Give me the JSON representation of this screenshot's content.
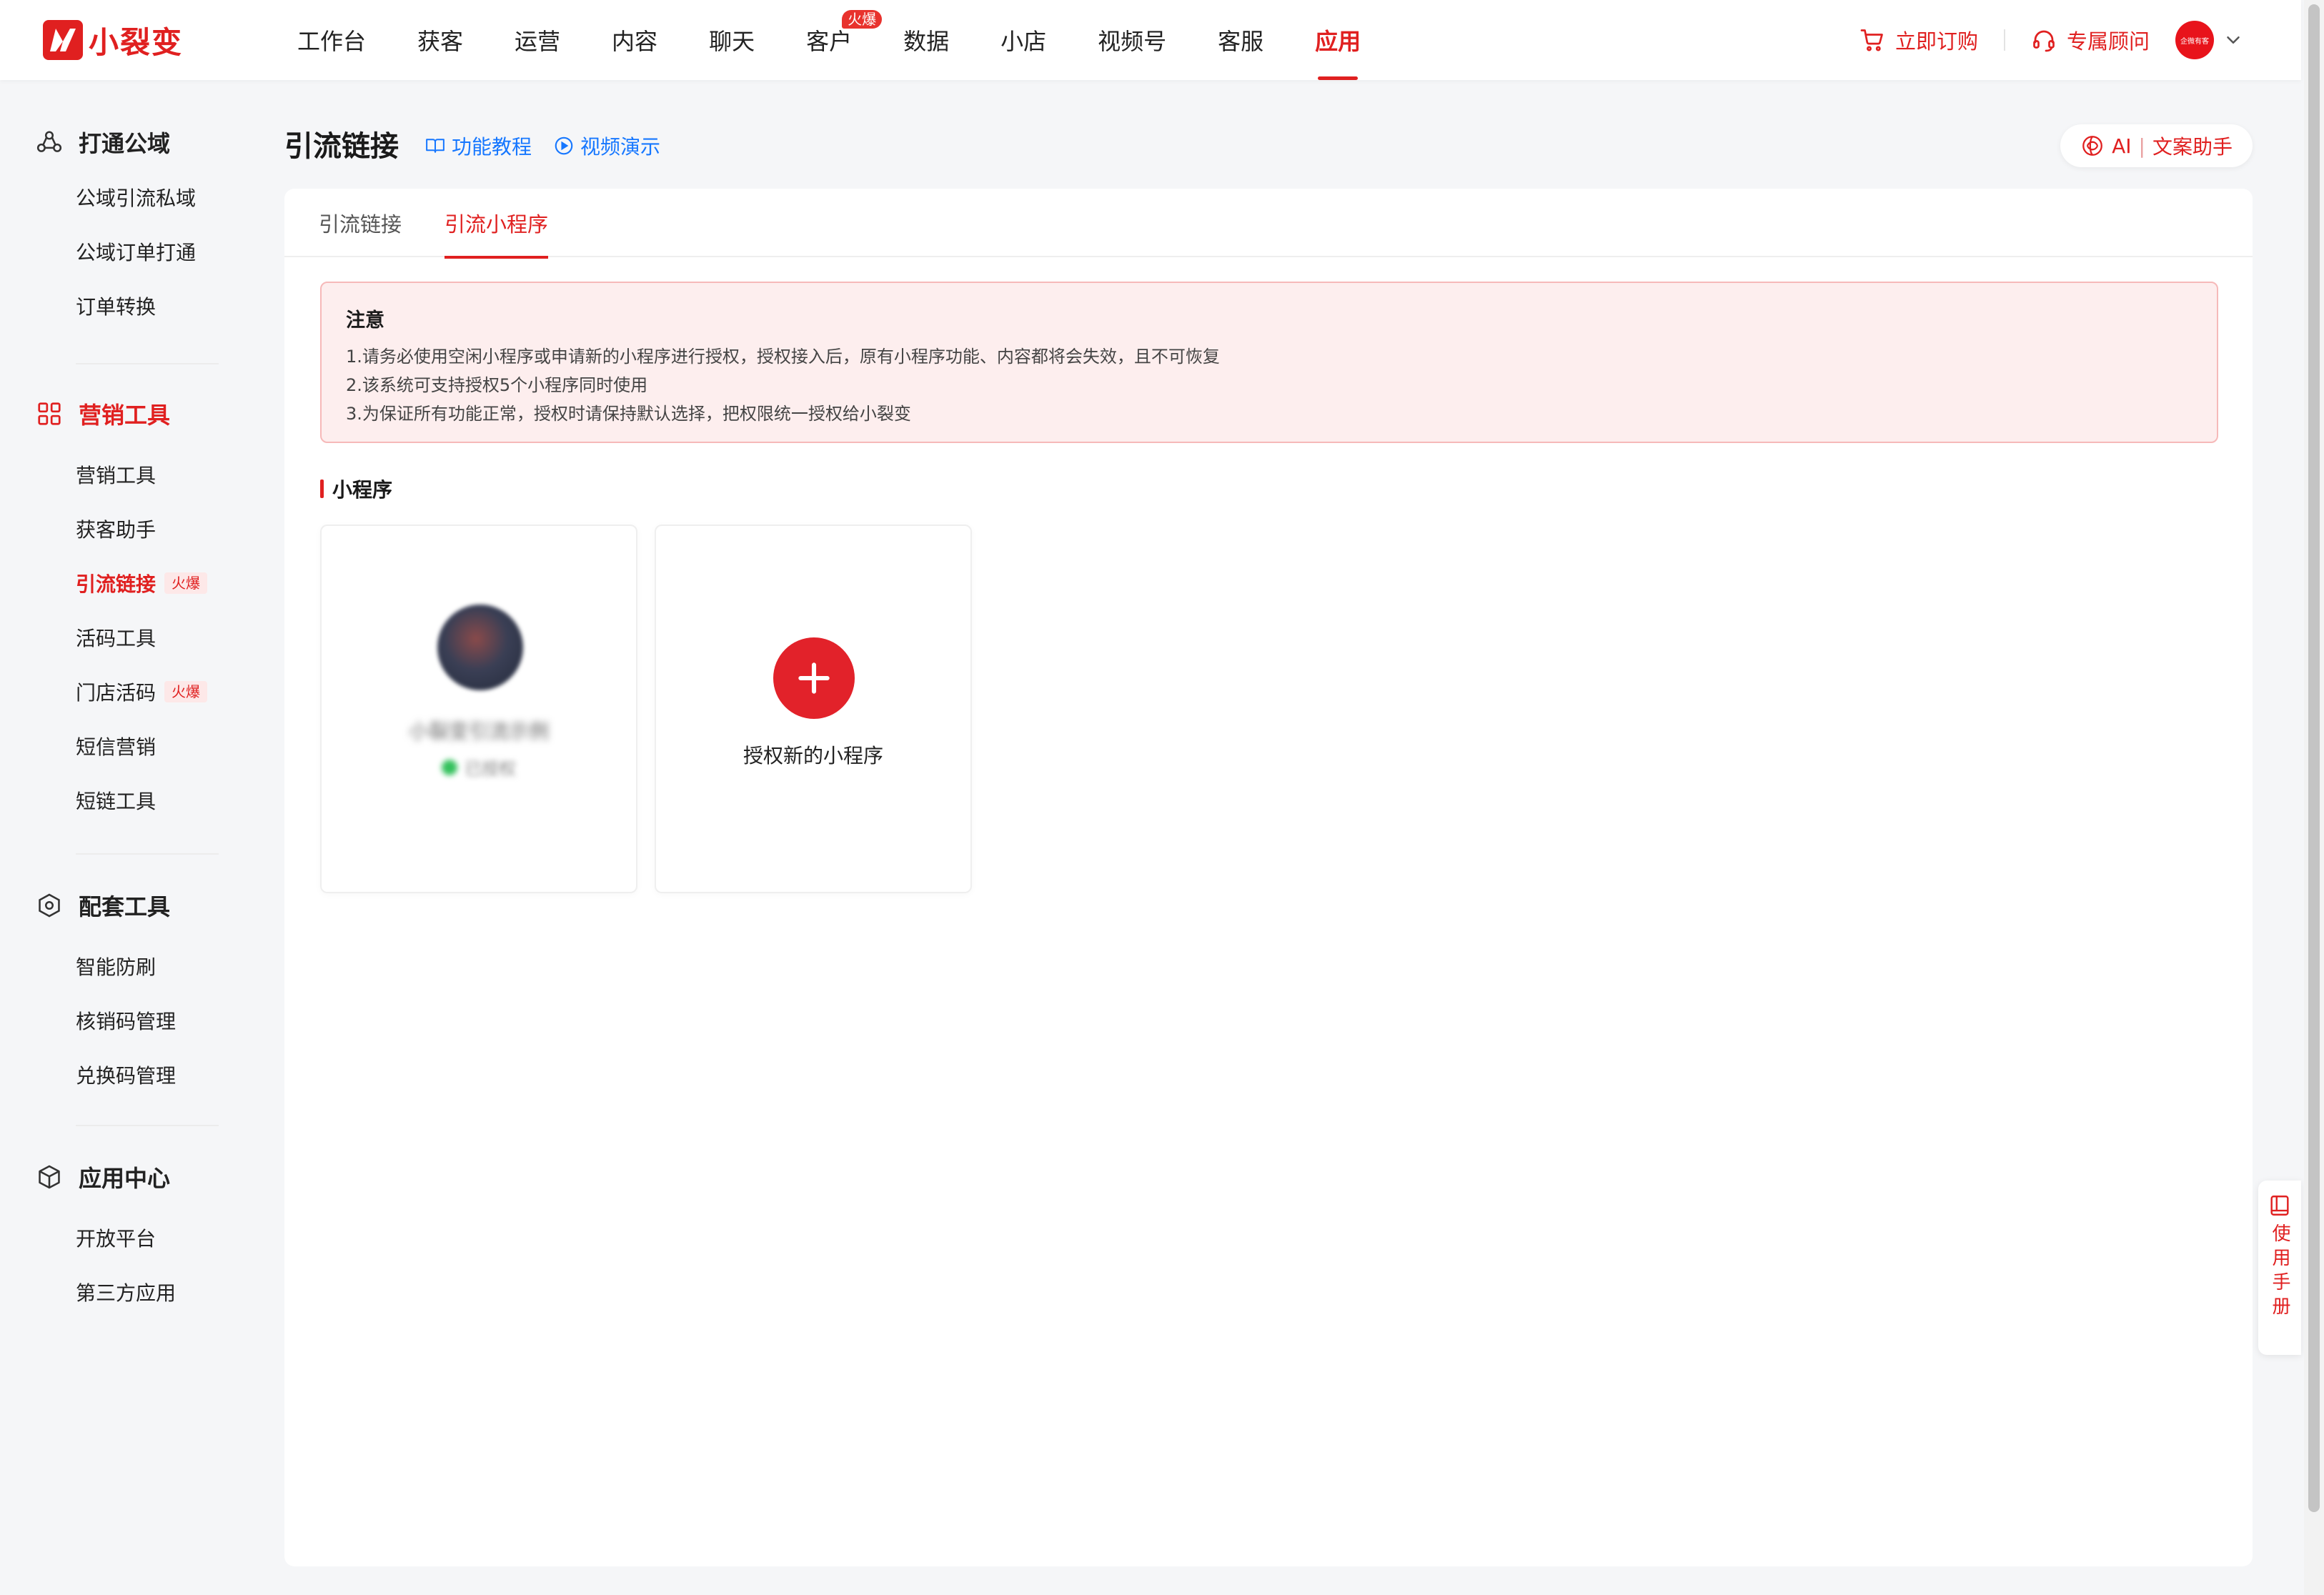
{
  "brand": {
    "name": "小裂变",
    "color": "#e02020"
  },
  "nav": {
    "items": [
      {
        "label": "工作台"
      },
      {
        "label": "获客"
      },
      {
        "label": "运营"
      },
      {
        "label": "内容"
      },
      {
        "label": "聊天"
      },
      {
        "label": "客户",
        "badge": "火爆"
      },
      {
        "label": "数据"
      },
      {
        "label": "小店"
      },
      {
        "label": "视频号"
      },
      {
        "label": "客服"
      },
      {
        "label": "应用",
        "active": true
      }
    ]
  },
  "topright": {
    "order_label": "立即订购",
    "advisor_label": "专属顾问",
    "avatar_text": "企微有客"
  },
  "sidebar": {
    "groups": [
      {
        "title": "打通公域",
        "icon": "globe-share-icon",
        "items": [
          "公域引流私域",
          "公域订单打通",
          "订单转换"
        ]
      },
      {
        "title": "营销工具",
        "icon": "grid-icon",
        "active": true,
        "items": [
          "营销工具",
          "获客助手",
          "引流链接",
          "活码工具",
          "门店活码",
          "短信营销",
          "短链工具"
        ],
        "tags": {
          "引流链接": "火爆",
          "门店活码": "火爆"
        },
        "active_item": "引流链接"
      },
      {
        "title": "配套工具",
        "icon": "hexagon-icon",
        "items": [
          "智能防刷",
          "核销码管理",
          "兑换码管理"
        ]
      },
      {
        "title": "应用中心",
        "icon": "box-icon",
        "items": [
          "开放平台",
          "第三方应用"
        ]
      }
    ]
  },
  "page": {
    "title": "引流链接",
    "tutorial_label": "功能教程",
    "video_label": "视频演示",
    "ai_label_a": "AI",
    "ai_sep": "|",
    "ai_label_b": "文案助手"
  },
  "tabs": [
    {
      "label": "引流链接"
    },
    {
      "label": "引流小程序",
      "active": true
    }
  ],
  "notice": {
    "title": "注意",
    "lines": [
      "1.请务必使用空闲小程序或申请新的小程序进行授权，授权接入后，原有小程序功能、内容都将会失效，且不可恢复",
      "2.该系统可支持授权5个小程序同时使用",
      "3.为保证所有功能正常，授权时请保持默认选择，把权限统一授权给小裂变"
    ]
  },
  "section": {
    "title": "小程序"
  },
  "mini_programs": [
    {
      "name": "小裂变引流示例",
      "status": "已授权"
    }
  ],
  "add_card": {
    "label": "授权新的小程序"
  },
  "float": {
    "manual_label": "使用手册"
  }
}
